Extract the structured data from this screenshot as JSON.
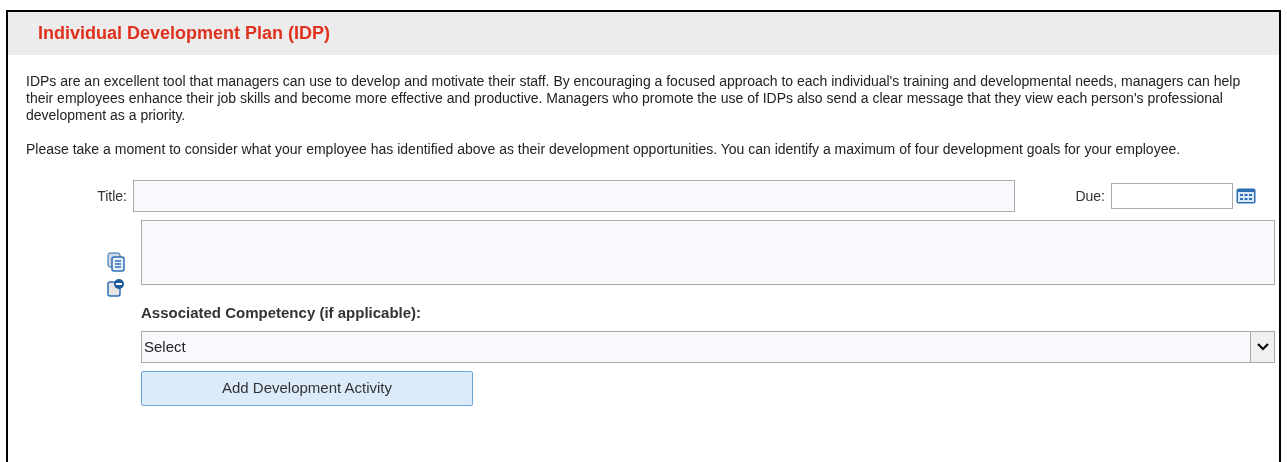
{
  "header": {
    "title": "Individual Development Plan (IDP)"
  },
  "paragraphs": [
    "IDPs are an excellent tool that managers can use to develop and motivate their staff. By encouraging a focused approach to each individual's training and developmental needs, managers can help their employees enhance their job skills and become more effective and productive. Managers who promote the use of IDPs also send a clear message that they view each person's professional development as a priority.",
    "Please take a moment to consider what your employee has identified above as their development opportunities. You can identify a maximum of four development goals for your employee."
  ],
  "form": {
    "title_label": "Title:",
    "due_label": "Due:",
    "competency_label": "Associated Competency (if applicable):",
    "competency_select": "Select",
    "add_button": "Add Development Activity"
  }
}
